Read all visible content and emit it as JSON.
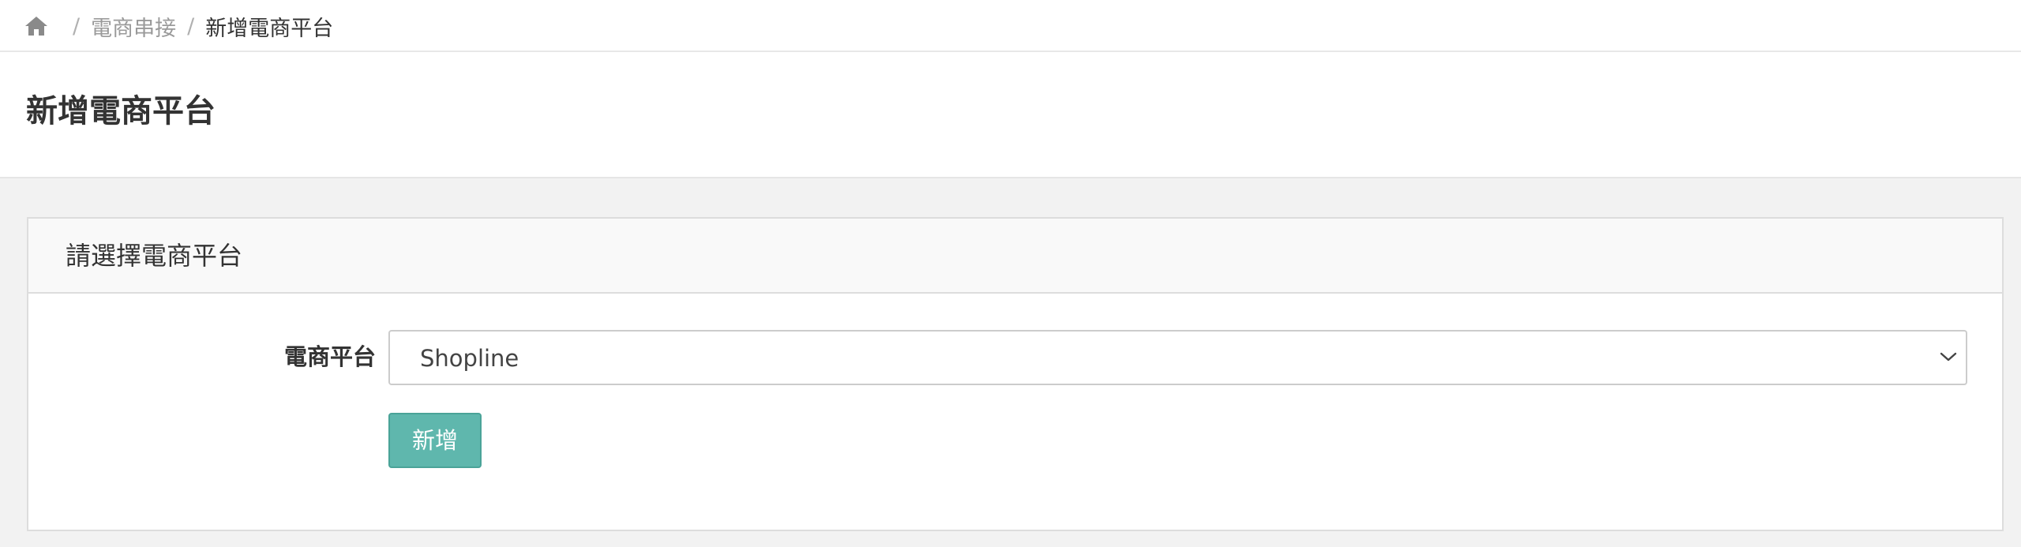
{
  "breadcrumb": {
    "home_icon": "home-icon",
    "separator": "/",
    "items": [
      {
        "label": "電商串接"
      },
      {
        "label": "新增電商平台"
      }
    ]
  },
  "page": {
    "title": "新增電商平台"
  },
  "panel": {
    "heading": "請選擇電商平台",
    "form": {
      "platform_label": "電商平台",
      "platform_value": "Shopline",
      "dropdown_icon": "chevron-down-icon"
    },
    "submit_label": "新增"
  },
  "colors": {
    "accent": "#5fb7ad",
    "background": "#f2f2f2",
    "panel_heading": "#f9f9f9"
  }
}
